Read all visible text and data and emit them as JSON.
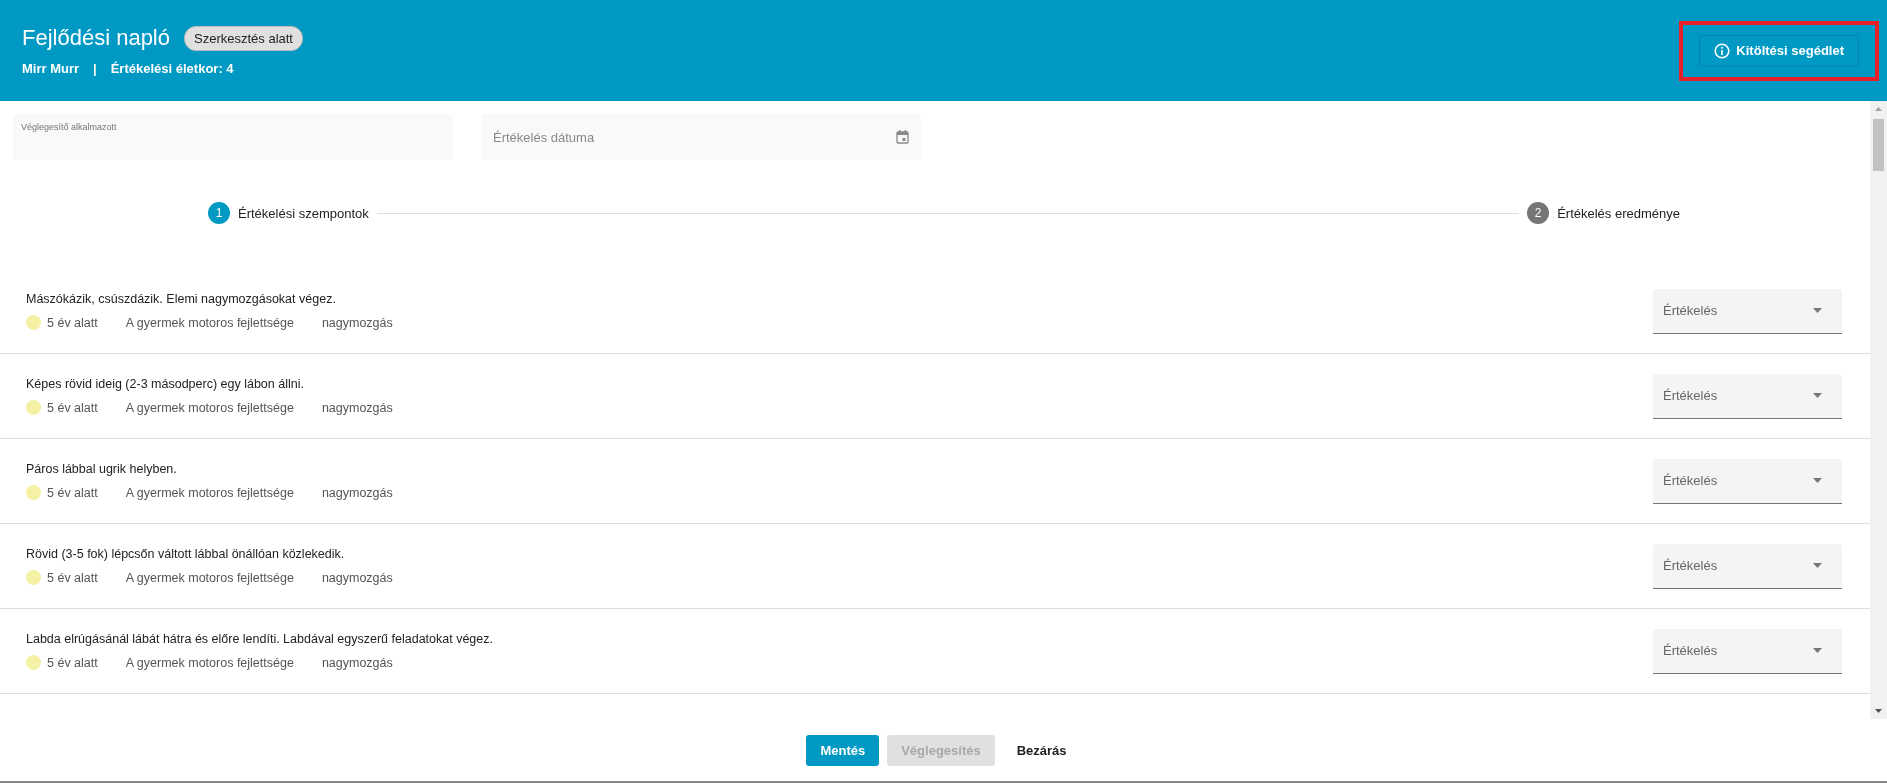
{
  "header": {
    "title": "Fejlődési napló",
    "status_badge": "Szerkesztés alatt",
    "child_name": "Mirr Murr",
    "separator": "|",
    "age_label": "Értékelési életkor: 4",
    "help_button": {
      "label": "Kitöltési segédlet",
      "highlighted": true
    }
  },
  "fields": [
    {
      "kind": "text",
      "label": "Véglegesítő alkalmazott"
    },
    {
      "kind": "date",
      "placeholder": "Értékelés dátuma"
    }
  ],
  "stepper": [
    {
      "number": "1",
      "label": "Értékelési szempontok",
      "selected": true
    },
    {
      "number": "2",
      "label": "Értékelés eredménye",
      "selected": false
    }
  ],
  "criteria": [
    {
      "text": "Mászókázik, csúszdázik. Elemi nagymozgásokat végez.",
      "color": "#f4f0a4",
      "age": "5 év alatt",
      "area": "A gyermek motoros fejlettsége",
      "subarea": "nagymozgás",
      "rating": {
        "placeholder": "Értékelés"
      }
    },
    {
      "text": "Képes rövid ideig (2-3 másodperc) egy lábon állni.",
      "color": "#f4f0a4",
      "age": "5 év alatt",
      "area": "A gyermek motoros fejlettsége",
      "subarea": "nagymozgás",
      "rating": {
        "placeholder": "Értékelés"
      }
    },
    {
      "text": "Páros lábbal ugrik helyben.",
      "color": "#f4f0a4",
      "age": "5 év alatt",
      "area": "A gyermek motoros fejlettsége",
      "subarea": "nagymozgás",
      "rating": {
        "placeholder": "Értékelés"
      }
    },
    {
      "text": "Rövid (3-5 fok) lépcsőn váltott lábbal önállóan közlekedik.",
      "color": "#f4f0a4",
      "age": "5 év alatt",
      "area": "A gyermek motoros fejlettsége",
      "subarea": "nagymozgás",
      "rating": {
        "placeholder": "Értékelés"
      }
    },
    {
      "text": "Labda elrúgásánál lábát hátra és előre lendíti. Labdával egyszerű feladatokat végez.",
      "color": "#f4f0a4",
      "age": "5 év alatt",
      "area": "A gyermek motoros fejlettsége",
      "subarea": "nagymozgás",
      "rating": {
        "placeholder": "Értékelés"
      }
    }
  ],
  "footer_buttons": [
    {
      "label": "Mentés",
      "kind": "primary",
      "disabled": false
    },
    {
      "label": "Véglegesítés",
      "kind": "primary",
      "disabled": true
    },
    {
      "label": "Bezárás",
      "kind": "text",
      "disabled": false
    }
  ]
}
